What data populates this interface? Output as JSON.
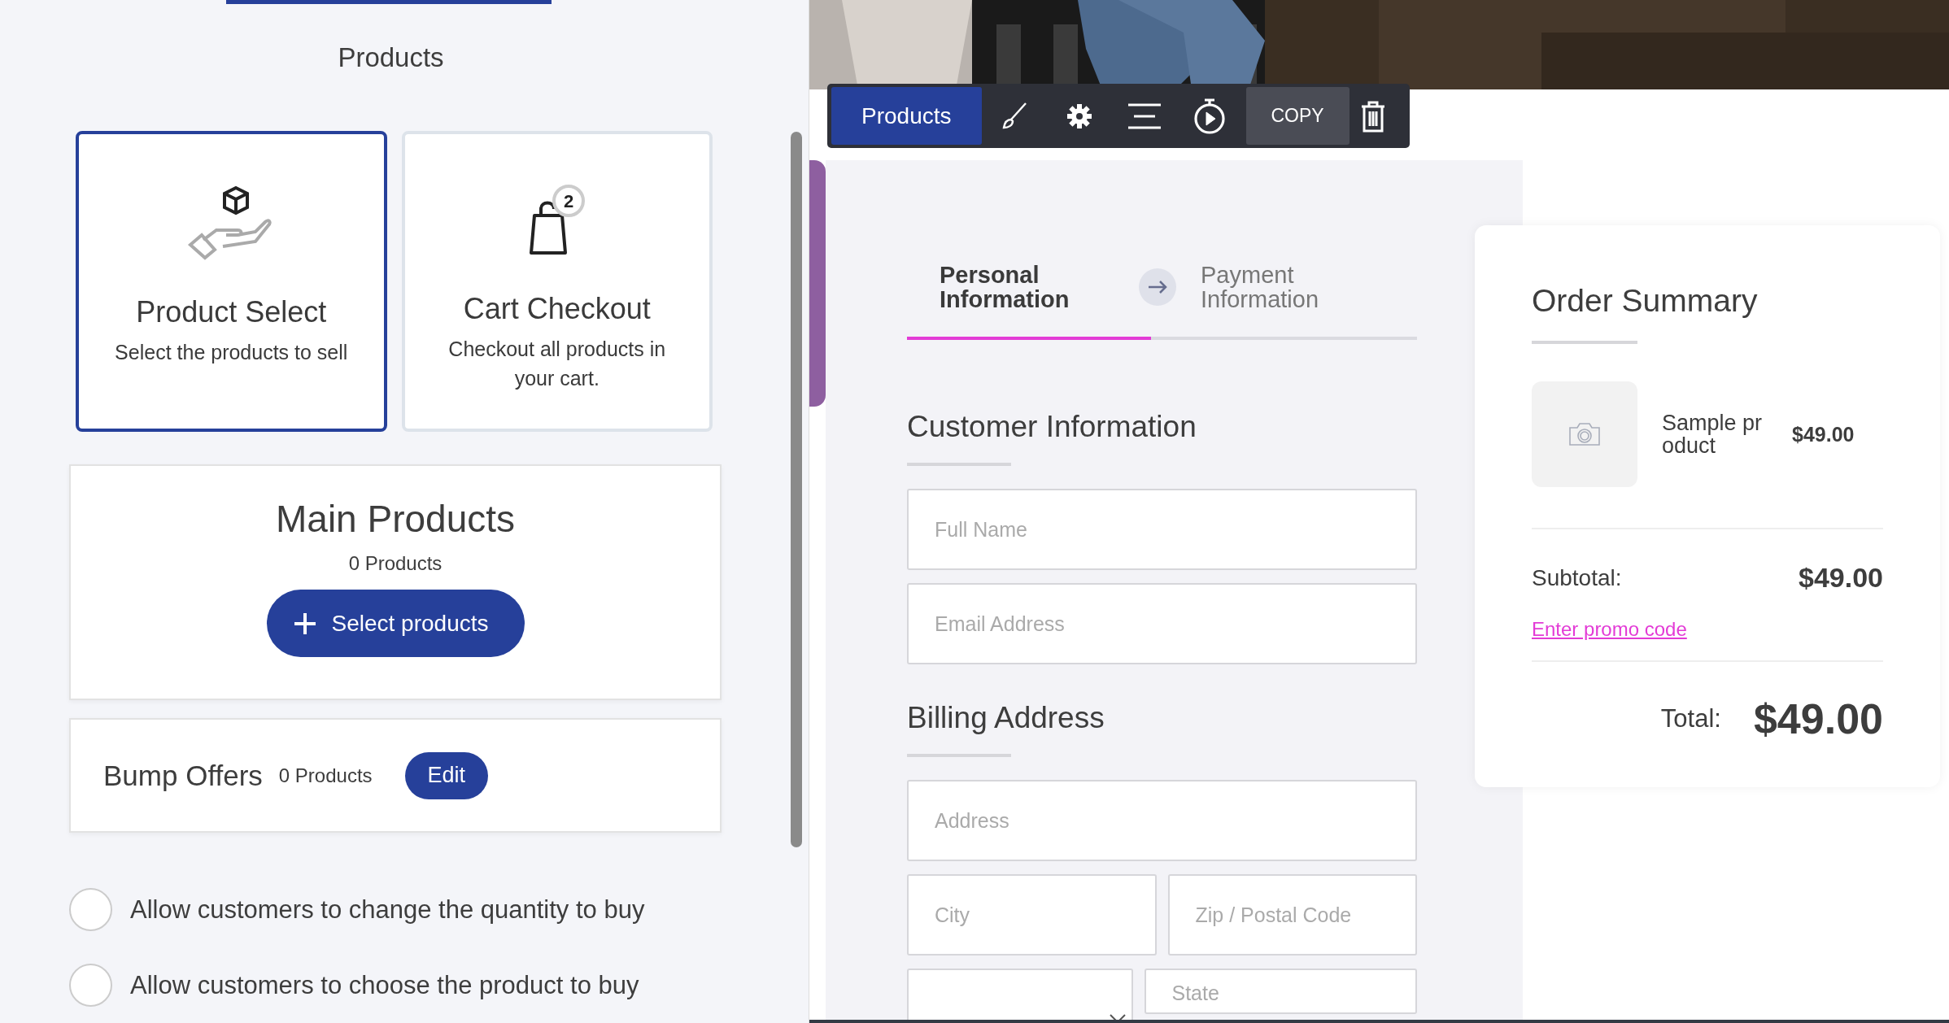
{
  "sidebar": {
    "title": "Products",
    "types": [
      {
        "title": "Product Select",
        "description": "Select the products to sell",
        "selected": true
      },
      {
        "title": "Cart Checkout",
        "description": "Checkout all products in your cart.",
        "badge": "2",
        "selected": false
      }
    ],
    "main_products": {
      "title": "Main Products",
      "count": "0 Products",
      "button": "Select products"
    },
    "bump_offers": {
      "title": "Bump Offers",
      "count": "0 Products",
      "button": "Edit"
    },
    "options": [
      {
        "label": "Allow customers to change the quantity to buy",
        "checked": false
      },
      {
        "label": "Allow customers to choose the product to buy",
        "checked": false
      }
    ]
  },
  "toolbar": {
    "label": "Products",
    "copy": "COPY"
  },
  "checkout": {
    "steps": [
      {
        "label": "Personal Information",
        "selected": true
      },
      {
        "label": "Payment Information",
        "selected": false
      }
    ],
    "sections": [
      {
        "heading": "Customer Information",
        "rows": [
          [
            {
              "kind": "text",
              "placeholder": "Full Name"
            }
          ],
          [
            {
              "kind": "text",
              "placeholder": "Email Address"
            }
          ]
        ]
      },
      {
        "heading": "Billing Address",
        "rows": [
          [
            {
              "kind": "text",
              "placeholder": "Address"
            }
          ],
          [
            {
              "kind": "text",
              "placeholder": "City"
            },
            {
              "kind": "text",
              "placeholder": "Zip / Postal Code"
            }
          ],
          [
            {
              "kind": "select"
            },
            {
              "kind": "text",
              "placeholder": "State"
            }
          ]
        ]
      }
    ]
  },
  "order_summary": {
    "title": "Order Summary",
    "items": [
      {
        "name": "Sample pr oduct",
        "price": "$49.00"
      }
    ],
    "subtotal_label": "Subtotal:",
    "subtotal": "$49.00",
    "promo_link": "Enter promo code",
    "total_label": "Total:",
    "total": "$49.00"
  }
}
